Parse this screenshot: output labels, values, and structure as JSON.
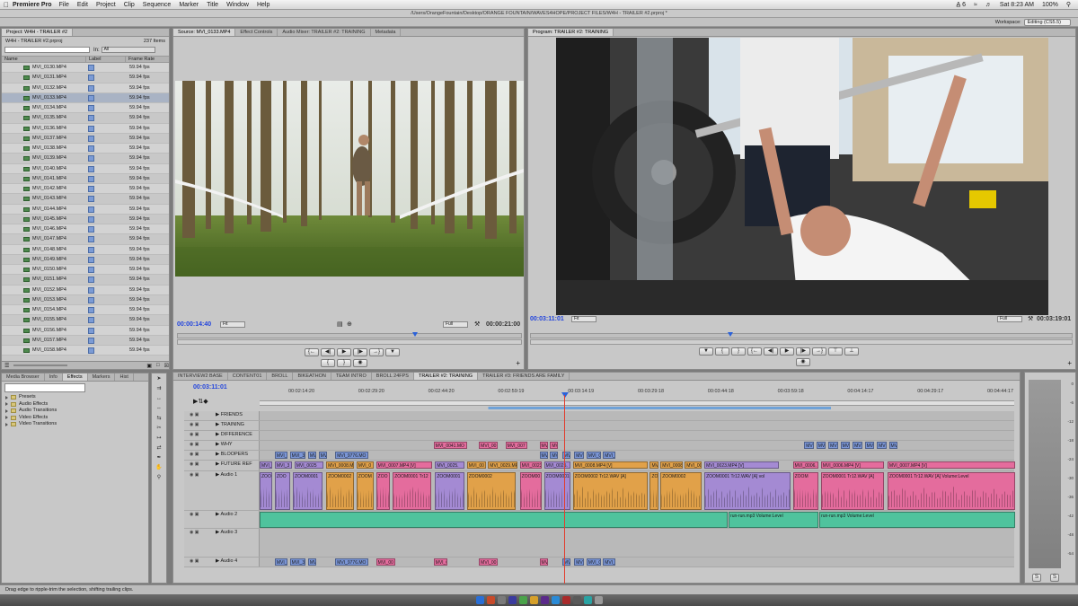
{
  "menubar": {
    "apple": "",
    "app_name": "Premiere Pro",
    "menus": [
      "File",
      "Edit",
      "Project",
      "Clip",
      "Sequence",
      "Marker",
      "Title",
      "Window",
      "Help"
    ],
    "status_icons": "A̲ 6",
    "battery": "100%",
    "clock": "Sat 8:23 AM"
  },
  "path_title": "/Users/OrangeFountain/Desktop/ORANGE FOUNTAIN/WAVES4HOPE/PROJECT FILES/W4H - TRAILER #2.prproj *",
  "workspace": {
    "label": "Workspace:",
    "value": "Editing (CS5.5)"
  },
  "project_panel": {
    "tabs": [
      "Project: W4H - TRAILER #2"
    ],
    "project_file": "W4H - TRAILER #2.prproj",
    "item_count": "237 Items",
    "in_label": "In:",
    "in_value": "All",
    "columns": [
      "Name",
      "Label",
      "Frame Rate"
    ],
    "rows": [
      {
        "name": "MVI_0130.MP4",
        "fps": "59.94 fps"
      },
      {
        "name": "MVI_0131.MP4",
        "fps": "59.94 fps"
      },
      {
        "name": "MVI_0132.MP4",
        "fps": "59.94 fps"
      },
      {
        "name": "MVI_0133.MP4",
        "fps": "59.94 fps"
      },
      {
        "name": "MVI_0134.MP4",
        "fps": "59.94 fps"
      },
      {
        "name": "MVI_0135.MP4",
        "fps": "59.94 fps"
      },
      {
        "name": "MVI_0136.MP4",
        "fps": "59.94 fps"
      },
      {
        "name": "MVI_0137.MP4",
        "fps": "59.94 fps"
      },
      {
        "name": "MVI_0138.MP4",
        "fps": "59.94 fps"
      },
      {
        "name": "MVI_0139.MP4",
        "fps": "59.94 fps"
      },
      {
        "name": "MVI_0140.MP4",
        "fps": "59.94 fps"
      },
      {
        "name": "MVI_0141.MP4",
        "fps": "59.94 fps"
      },
      {
        "name": "MVI_0142.MP4",
        "fps": "59.94 fps"
      },
      {
        "name": "MVI_0143.MP4",
        "fps": "59.94 fps"
      },
      {
        "name": "MVI_0144.MP4",
        "fps": "59.94 fps"
      },
      {
        "name": "MVI_0145.MP4",
        "fps": "59.94 fps"
      },
      {
        "name": "MVI_0146.MP4",
        "fps": "59.94 fps"
      },
      {
        "name": "MVI_0147.MP4",
        "fps": "59.94 fps"
      },
      {
        "name": "MVI_0148.MP4",
        "fps": "59.94 fps"
      },
      {
        "name": "MVI_0149.MP4",
        "fps": "59.94 fps"
      },
      {
        "name": "MVI_0150.MP4",
        "fps": "59.94 fps"
      },
      {
        "name": "MVI_0151.MP4",
        "fps": "59.94 fps"
      },
      {
        "name": "MVI_0152.MP4",
        "fps": "59.94 fps"
      },
      {
        "name": "MVI_0153.MP4",
        "fps": "59.94 fps"
      },
      {
        "name": "MVI_0154.MP4",
        "fps": "59.94 fps"
      },
      {
        "name": "MVI_0155.MP4",
        "fps": "59.94 fps"
      },
      {
        "name": "MVI_0156.MP4",
        "fps": "59.94 fps"
      },
      {
        "name": "MVI_0157.MP4",
        "fps": "59.94 fps"
      },
      {
        "name": "MVI_0158.MP4",
        "fps": "59.94 fps"
      }
    ],
    "selected_row": "MVI_0133.MP4"
  },
  "effects_panel": {
    "tabs": [
      "Media Browser",
      "Info",
      "Effects",
      "Markers",
      "Hist"
    ],
    "active_tab": "Effects",
    "items": [
      "Presets",
      "Audio Effects",
      "Audio Transitions",
      "Video Effects",
      "Video Transitions"
    ]
  },
  "source_monitor": {
    "tabs": [
      "Source: MVI_0133.MP4",
      "Effect Controls",
      "Audio Mixer: TRAILER #2: TRAINING",
      "Metadata"
    ],
    "timecode": "00:00:14:40",
    "fit": "Fit",
    "quality": "Full",
    "duration": "00:00:21:00",
    "playhead_fraction": 0.69
  },
  "program_monitor": {
    "tabs": [
      "Program: TRAILER #2: TRAINING"
    ],
    "timecode": "00:03:11:01",
    "fit": "Fit",
    "quality": "Full",
    "duration": "00:03:19:01",
    "playhead_fraction": 0.37
  },
  "timeline": {
    "tabs": [
      "INTERVIEW2 BASE",
      "CONTENT01",
      "BROLL",
      "BIKEATHON",
      "TEAM INTRO",
      "BROLL 24FPS",
      "TRAILER #2: TRAINING",
      "TRAILER #3: FRIENDS ARE FAMILY"
    ],
    "active_tab": "TRAILER #2: TRAINING",
    "timecode": "00:03:11:01",
    "ticks": [
      "00:02:14:20",
      "00:02:29:20",
      "00:02:44:20",
      "00:02:59:19",
      "00:03:14:19",
      "00:03:29:18",
      "00:03:44:18",
      "00:03:59:18",
      "00:04:14:17",
      "00:04:29:17",
      "00:04:44:17"
    ],
    "tracks": [
      {
        "label": "FRIENDS",
        "clips": []
      },
      {
        "label": "TRAINING",
        "clips": []
      },
      {
        "label": "DIFFERENCE",
        "clips": []
      },
      {
        "label": "WHY",
        "clips": [
          {
            "t": "MVI_0041.MO",
            "c": "pink",
            "s": 0.23,
            "w": 0.045
          },
          {
            "t": "MVI_00",
            "c": "pink",
            "s": 0.29,
            "w": 0.026
          },
          {
            "t": "MVI_007",
            "c": "pink",
            "s": 0.325,
            "w": 0.03
          },
          {
            "t": "MV",
            "c": "pink",
            "s": 0.37,
            "w": 0.012
          },
          {
            "t": "MV",
            "c": "pink",
            "s": 0.384,
            "w": 0.012
          },
          {
            "t": "MVI",
            "c": "blue",
            "s": 0.72,
            "w": 0.014
          },
          {
            "t": "MVI",
            "c": "blue",
            "s": 0.736,
            "w": 0.014
          },
          {
            "t": "MV",
            "c": "blue",
            "s": 0.752,
            "w": 0.014
          },
          {
            "t": "MVI",
            "c": "blue",
            "s": 0.768,
            "w": 0.014
          },
          {
            "t": "MVI",
            "c": "blue",
            "s": 0.784,
            "w": 0.014
          },
          {
            "t": "MVI",
            "c": "blue",
            "s": 0.8,
            "w": 0.014
          },
          {
            "t": "MVI",
            "c": "blue",
            "s": 0.816,
            "w": 0.014
          },
          {
            "t": "MV",
            "c": "blue",
            "s": 0.832,
            "w": 0.012
          }
        ]
      },
      {
        "label": "BLOOPERS",
        "clips": [
          {
            "t": "MVI_",
            "c": "blue",
            "s": 0.02,
            "w": 0.018
          },
          {
            "t": "MVI_3",
            "c": "blue",
            "s": 0.04,
            "w": 0.022
          },
          {
            "t": "MV",
            "c": "blue",
            "s": 0.064,
            "w": 0.012
          },
          {
            "t": "MV",
            "c": "blue",
            "s": 0.078,
            "w": 0.012
          },
          {
            "t": "MVI_9776.MO",
            "c": "blue",
            "s": 0.1,
            "w": 0.045
          },
          {
            "t": "MV",
            "c": "blue",
            "s": 0.37,
            "w": 0.012
          },
          {
            "t": "MV",
            "c": "blue",
            "s": 0.384,
            "w": 0.012
          },
          {
            "t": "MV",
            "c": "blue",
            "s": 0.4,
            "w": 0.012
          },
          {
            "t": "MVI",
            "c": "blue",
            "s": 0.416,
            "w": 0.014
          },
          {
            "t": "MVI_01",
            "c": "blue",
            "s": 0.432,
            "w": 0.02
          },
          {
            "t": "MVI_",
            "c": "blue",
            "s": 0.454,
            "w": 0.018
          }
        ]
      },
      {
        "label": "FUTURE REF",
        "clips": [
          {
            "t": "MVI_",
            "c": "lav",
            "s": 0.0,
            "w": 0.018
          },
          {
            "t": "MVI_3",
            "c": "lav",
            "s": 0.02,
            "w": 0.024
          },
          {
            "t": "MVI_0025",
            "c": "lav",
            "s": 0.046,
            "w": 0.04
          },
          {
            "t": "MVI_0008.MP4",
            "c": "orange",
            "s": 0.088,
            "w": 0.038
          },
          {
            "t": "MVI_0",
            "c": "orange",
            "s": 0.128,
            "w": 0.024
          },
          {
            "t": "MVI_0007.MP4 [V]",
            "c": "pink",
            "s": 0.154,
            "w": 0.075
          },
          {
            "t": "MVI_0025.",
            "c": "lav",
            "s": 0.232,
            "w": 0.04
          },
          {
            "t": "MVI_00",
            "c": "orange",
            "s": 0.274,
            "w": 0.026
          },
          {
            "t": "MVI_0029.MP4",
            "c": "orange",
            "s": 0.302,
            "w": 0.04
          },
          {
            "t": "MVI_0023",
            "c": "pink",
            "s": 0.344,
            "w": 0.03
          },
          {
            "t": "MVI_0025.",
            "c": "lav",
            "s": 0.376,
            "w": 0.036
          },
          {
            "t": "MVI_0008.MP4 [V]",
            "c": "orange",
            "s": 0.414,
            "w": 0.1
          },
          {
            "t": "MV",
            "c": "orange",
            "s": 0.516,
            "w": 0.012
          },
          {
            "t": "MVI_0008",
            "c": "orange",
            "s": 0.53,
            "w": 0.03
          },
          {
            "t": "MVI_00",
            "c": "orange",
            "s": 0.562,
            "w": 0.024
          },
          {
            "t": "MVI_0023.MP4 [V]",
            "c": "lav",
            "s": 0.588,
            "w": 0.1
          },
          {
            "t": "MVI_0006.",
            "c": "pink",
            "s": 0.705,
            "w": 0.035
          },
          {
            "t": "MVI_0006.MP4 [V]",
            "c": "pink",
            "s": 0.742,
            "w": 0.085
          },
          {
            "t": "MVI_0007.MP4 [V]",
            "c": "pink",
            "s": 0.83,
            "w": 0.17
          }
        ]
      },
      {
        "label": "Audio 1",
        "audio": true,
        "clips": [
          {
            "t": "ZOO",
            "c": "lav",
            "s": 0.0,
            "w": 0.018
          },
          {
            "t": "ZOO",
            "c": "lav",
            "s": 0.02,
            "w": 0.022
          },
          {
            "t": "ZOOM0001",
            "c": "lav",
            "s": 0.044,
            "w": 0.04
          },
          {
            "t": "ZOOM0002",
            "c": "orange",
            "s": 0.088,
            "w": 0.038
          },
          {
            "t": "ZOOM",
            "c": "orange",
            "s": 0.128,
            "w": 0.024
          },
          {
            "t": "ZOO",
            "c": "pink",
            "s": 0.154,
            "w": 0.02
          },
          {
            "t": "ZOOM0001 Tr12",
            "c": "pink",
            "s": 0.176,
            "w": 0.052
          },
          {
            "t": "ZOOM0001",
            "c": "lav",
            "s": 0.232,
            "w": 0.04
          },
          {
            "t": "ZOOM0002",
            "c": "orange",
            "s": 0.274,
            "w": 0.066
          },
          {
            "t": "ZOOM00",
            "c": "pink",
            "s": 0.344,
            "w": 0.03
          },
          {
            "t": "ZOOM0001",
            "c": "lav",
            "s": 0.376,
            "w": 0.036
          },
          {
            "t": "ZOOM0002 Tr12.WAV [A]",
            "c": "orange",
            "s": 0.414,
            "w": 0.1
          },
          {
            "t": "ZOOM",
            "c": "orange",
            "s": 0.516,
            "w": 0.012
          },
          {
            "t": "ZOOM0002",
            "c": "orange",
            "s": 0.53,
            "w": 0.056
          },
          {
            "t": "ZOOM0001 Tr12.WAV [A] vol",
            "c": "lav",
            "s": 0.588,
            "w": 0.115
          },
          {
            "t": "ZOOM",
            "c": "pink",
            "s": 0.705,
            "w": 0.035
          },
          {
            "t": "ZOOM0001 Tr12.WAV [A]",
            "c": "pink",
            "s": 0.742,
            "w": 0.085
          },
          {
            "t": "ZOOM0001 Tr12.WAV [A] Volume:Level",
            "c": "pink",
            "s": 0.83,
            "w": 0.17
          }
        ]
      },
      {
        "label": "Audio 2",
        "clips": [
          {
            "t": "",
            "c": "teal",
            "s": 0.0,
            "w": 0.62
          },
          {
            "t": "run-run.mp3 Volume:Level",
            "c": "teal",
            "s": 0.62,
            "w": 0.12
          },
          {
            "t": "run-run.mp3 Volume:Level",
            "c": "teal",
            "s": 0.74,
            "w": 0.26
          }
        ]
      },
      {
        "label": "Audio 3",
        "clips": []
      },
      {
        "label": "Audio 4",
        "clips": [
          {
            "t": "MVI_",
            "c": "blue",
            "s": 0.02,
            "w": 0.018
          },
          {
            "t": "MVI_3",
            "c": "blue",
            "s": 0.04,
            "w": 0.022
          },
          {
            "t": "MV",
            "c": "blue",
            "s": 0.064,
            "w": 0.012
          },
          {
            "t": "MVI_9776.MO",
            "c": "blue",
            "s": 0.1,
            "w": 0.045
          },
          {
            "t": "MVI_00",
            "c": "pink",
            "s": 0.154,
            "w": 0.026
          },
          {
            "t": "MVI_0",
            "c": "pink",
            "s": 0.23,
            "w": 0.02
          },
          {
            "t": "MVI_00",
            "c": "pink",
            "s": 0.29,
            "w": 0.026
          },
          {
            "t": "MV",
            "c": "pink",
            "s": 0.37,
            "w": 0.012
          },
          {
            "t": "MV",
            "c": "blue",
            "s": 0.4,
            "w": 0.012
          },
          {
            "t": "MVI",
            "c": "blue",
            "s": 0.416,
            "w": 0.014
          },
          {
            "t": "MVI_01",
            "c": "blue",
            "s": 0.432,
            "w": 0.02
          },
          {
            "t": "MVI_",
            "c": "blue",
            "s": 0.454,
            "w": 0.018
          }
        ]
      }
    ]
  },
  "meter_scale": [
    "0",
    "-6",
    "-12",
    "-18",
    "-24",
    "-30",
    "-36",
    "-42",
    "-48",
    "-54"
  ],
  "meter_buttons": [
    "S",
    "S"
  ],
  "status_bar": "Drag edge to ripple-trim the selection, shifting trailing clips.",
  "colors": {
    "accent": "#2244dd",
    "playhead": "#e23c2c",
    "clip_blue": "#7a95d6",
    "clip_pink": "#e46c9d",
    "clip_lavender": "#a48ad3",
    "clip_orange": "#e1a149",
    "clip_teal": "#4fc39d"
  }
}
